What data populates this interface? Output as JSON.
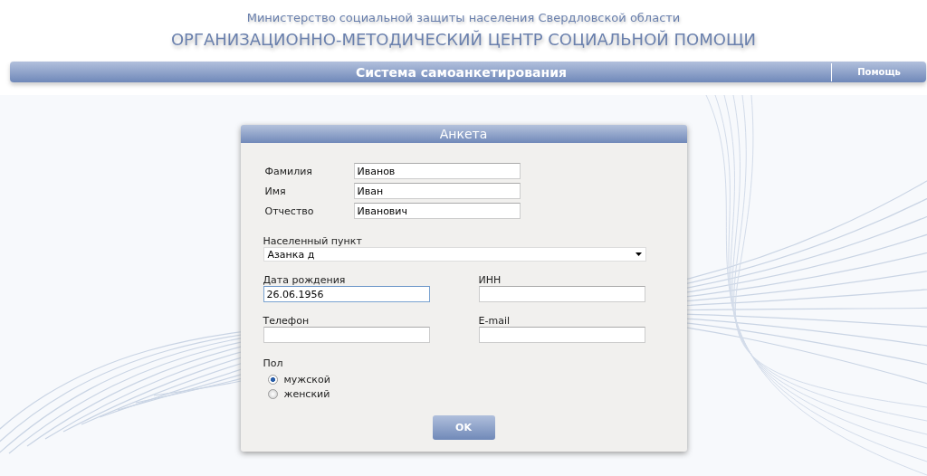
{
  "header": {
    "ministry": "Министерство социальной защиты населения Свердловской области",
    "center": "ОРГАНИЗАЦИОННО-МЕТОДИЧЕСКИЙ ЦЕНТР СОЦИАЛЬНОЙ ПОМОЩИ"
  },
  "nav_bar": {
    "title": "Система самоанкетирования",
    "help": "Помощь"
  },
  "form": {
    "title": "Анкета",
    "name_fields": [
      {
        "label": "Фамилия",
        "value": "Иванов"
      },
      {
        "label": "Имя",
        "value": "Иван"
      },
      {
        "label": "Отчество",
        "value": "Иванович"
      }
    ],
    "locality": {
      "label": "Населенный пункт",
      "value": "Азанка д"
    },
    "grid_fields": [
      {
        "label": "Дата рождения",
        "value": "26.06.1956",
        "focused": true
      },
      {
        "label": "ИНН",
        "focused": false
      },
      {
        "label": "Телефон",
        "focused": false
      },
      {
        "label": "E-mail",
        "focused": false
      }
    ],
    "gender": {
      "label": "Пол",
      "options": [
        {
          "label": "мужской",
          "selected": true
        },
        {
          "label": "женский",
          "selected": false
        }
      ]
    },
    "submit": "OK"
  }
}
